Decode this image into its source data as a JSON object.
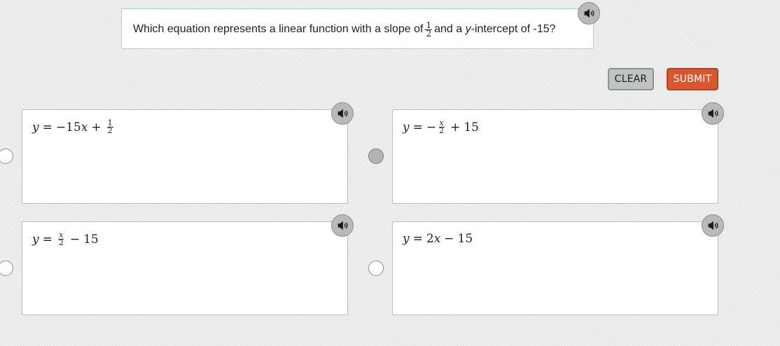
{
  "question": {
    "text_before": "Which equation represents a linear function with a slope of",
    "slope_fraction": {
      "numerator": "1",
      "denominator": "2"
    },
    "text_and": "and a",
    "var_y": "y",
    "text_after": "-intercept of -15?"
  },
  "buttons": {
    "clear_label": "CLEAR",
    "submit_label": "SUBMIT"
  },
  "colors": {
    "submit": "#d8572e",
    "question_border": "#9fd8d8"
  },
  "icons": {
    "audio": "speaker-icon"
  },
  "options": [
    {
      "selected": false,
      "lhs": "y",
      "eq": "=",
      "part1": "−15",
      "var": "x",
      "op": "+",
      "frac_num": "1",
      "frac_den": "2"
    },
    {
      "selected": true,
      "lhs": "y",
      "eq": "=",
      "sign": "−",
      "frac_num": "x",
      "frac_den": "2",
      "op": "+",
      "part2": "15"
    },
    {
      "selected": false,
      "lhs": "y",
      "eq": "=",
      "frac_num": "x",
      "frac_den": "2",
      "op": "−",
      "part2": "15"
    },
    {
      "selected": false,
      "lhs": "y",
      "eq": "=",
      "part1": "2",
      "var": "x",
      "op": "−",
      "part2": "15"
    }
  ]
}
